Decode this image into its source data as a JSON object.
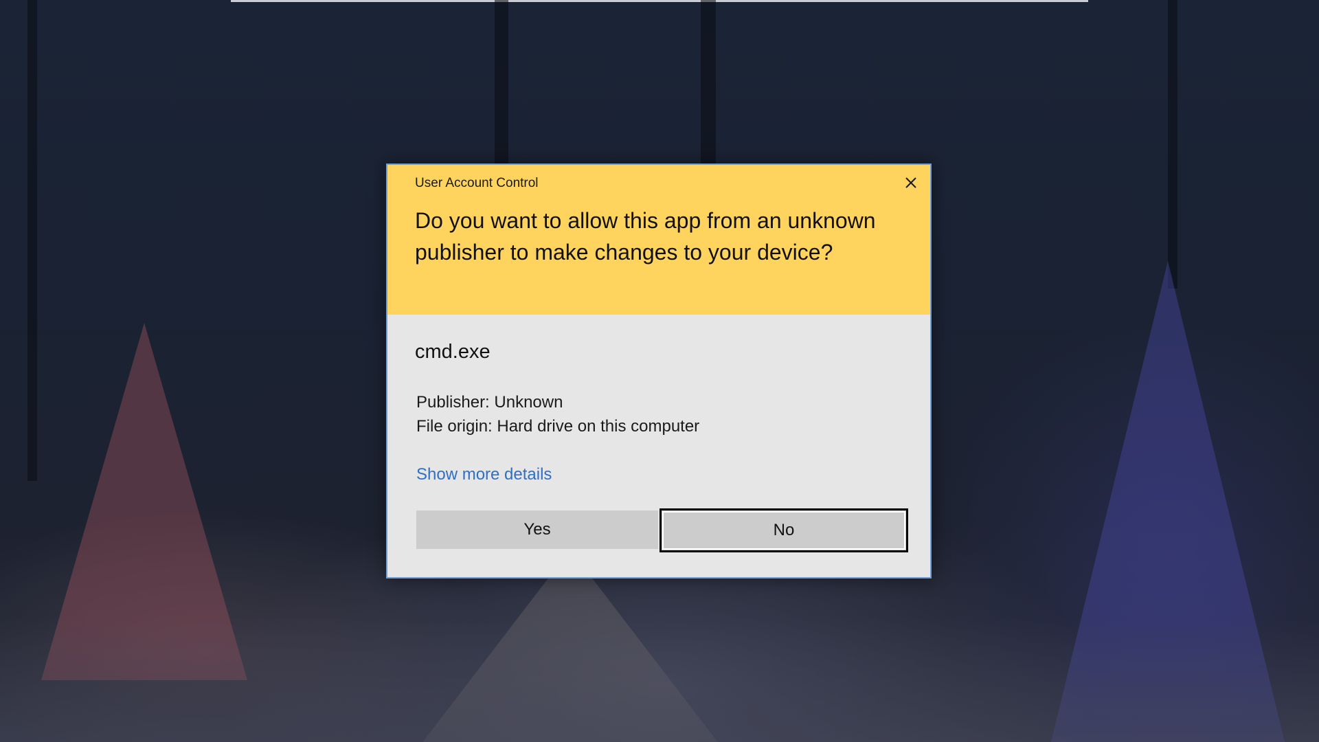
{
  "dialog": {
    "title": "User Account Control",
    "question": "Do you want to allow this app from an unknown publisher to make changes to your device?",
    "app_name": "cmd.exe",
    "publisher": "Publisher: Unknown",
    "file_origin": "File origin: Hard drive on this computer",
    "details_link": "Show more details",
    "yes_label": "Yes",
    "no_label": "No",
    "close_icon": "close-icon"
  },
  "colors": {
    "header_bg": "#ffd45e",
    "body_bg": "#e6e6e6",
    "link": "#2f6fc4",
    "button_bg": "#cccccc",
    "dialog_border": "#6fa0d8"
  }
}
